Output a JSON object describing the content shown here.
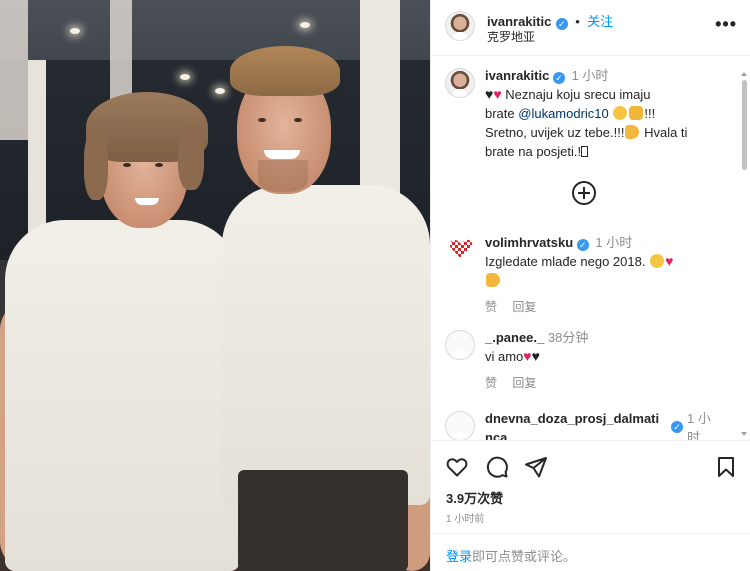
{
  "post": {
    "author": "ivanrakitic",
    "follow_label": "关注",
    "dot": "•",
    "location": "克罗地亚",
    "more_label": "•••"
  },
  "caption": {
    "username": "ivanrakitic",
    "time": "1 小时",
    "line1": "Neznaju koju srecu imaju",
    "line2_prefix": "brate ",
    "mention": "@lukamodric10",
    "line2_suffix": "!!!",
    "line3": "Sretno, uvijek uz tebe.!!!",
    "line3_suffix": " Hvala ti",
    "line4": "brate na posjeti.!"
  },
  "load_more_icon": "plus-circle-icon",
  "comments": [
    {
      "username": "volimhrvatsku",
      "time": "1 小时",
      "text": "Izgledate mlađe nego 2018.",
      "like_label": "赞",
      "reply_label": "回复"
    },
    {
      "username": "_.panee._",
      "time": "38分钟",
      "text": "vi amo",
      "like_label": "赞",
      "reply_label": "回复"
    },
    {
      "username_line1": "dnevna_doza_prosj_dalmati",
      "username_line2": "nca",
      "time_line1": "1 小",
      "time_line2": "时"
    }
  ],
  "footer": {
    "likes": "3.9万次赞",
    "posted": "1 小时前",
    "login_link": "登录",
    "login_text": "即可点赞或评论。"
  },
  "icons": [
    "heart-icon",
    "comment-icon",
    "share-icon",
    "bookmark-icon",
    "verified-icon",
    "ellipsis-icon"
  ],
  "colors": {
    "verified_blue": "#3897f0",
    "link_blue": "#0095f6",
    "mention_blue": "#00376b",
    "meta_gray": "#8e8e8e",
    "heart_red": "#e0245e"
  }
}
